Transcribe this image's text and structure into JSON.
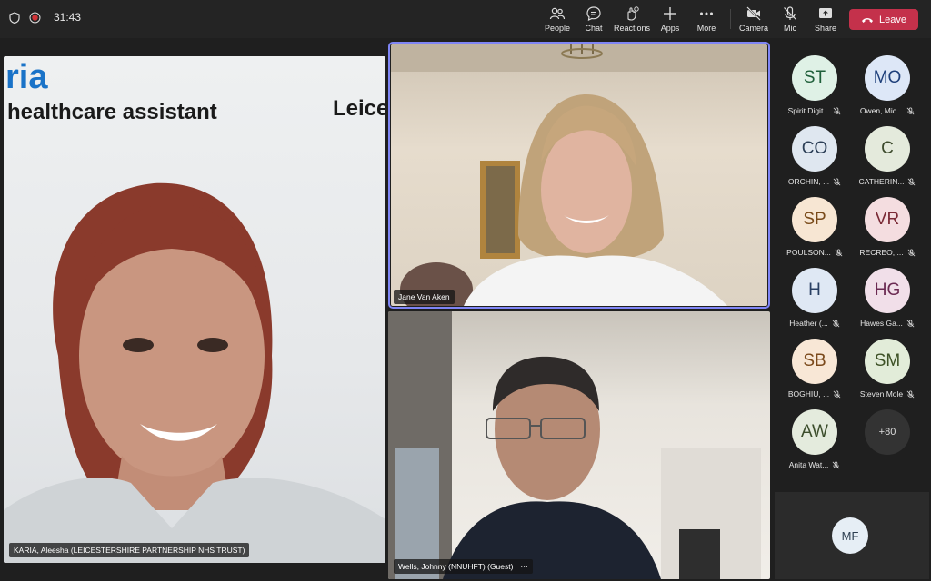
{
  "topbar": {
    "timer": "31:43",
    "buttons": {
      "people": "People",
      "chat": "Chat",
      "reactions": "Reactions",
      "apps": "Apps",
      "more": "More",
      "camera": "Camera",
      "mic": "Mic",
      "share": "Share"
    },
    "leave": "Leave",
    "leave_color": "#c4314b"
  },
  "tiles": {
    "left": {
      "brand_text": "ria",
      "role_text": "healthcare assistant",
      "org_text": "Leice",
      "name": "KARIA, Aleesha (LEICESTERSHIRE PARTNERSHIP NHS TRUST)"
    },
    "right_top": {
      "name": "Jane Van Aken"
    },
    "right_bottom": {
      "name": "Wells, Johnny (NNUHFT) (Guest)",
      "more": "···"
    }
  },
  "participants": [
    {
      "initials": "ST",
      "label": "Spirit Digit...",
      "bg": "#dff1e6",
      "fg": "#1f5f3a"
    },
    {
      "initials": "MO",
      "label": "Owen, Mic...",
      "bg": "#dde7f7",
      "fg": "#1e3f7a"
    },
    {
      "initials": "CO",
      "label": "ORCHIN, ...",
      "bg": "#dfe7f0",
      "fg": "#2b3e56"
    },
    {
      "initials": "C",
      "label": "CATHERIN...",
      "bg": "#e4eadc",
      "fg": "#3c4a2c"
    },
    {
      "initials": "SP",
      "label": "POULSON...",
      "bg": "#f7e6d3",
      "fg": "#7a4b1a"
    },
    {
      "initials": "VR",
      "label": "RECREO, ...",
      "bg": "#f4dde0",
      "fg": "#7a2a36"
    },
    {
      "initials": "H",
      "label": "Heather (...",
      "bg": "#dfe8f4",
      "fg": "#2a4063"
    },
    {
      "initials": "HG",
      "label": "Hawes Ga...",
      "bg": "#f1dfe9",
      "fg": "#6b2a52"
    },
    {
      "initials": "SB",
      "label": "BOGHIU, ...",
      "bg": "#f8e7d6",
      "fg": "#7b4a1c"
    },
    {
      "initials": "SM",
      "label": "Steven Mole",
      "bg": "#e2ecd9",
      "fg": "#3e5227"
    },
    {
      "initials": "AW",
      "label": "Anita Wat...",
      "bg": "#e4ebdd",
      "fg": "#3c4e2c"
    }
  ],
  "overflow": "+80",
  "self_initials": "MF"
}
